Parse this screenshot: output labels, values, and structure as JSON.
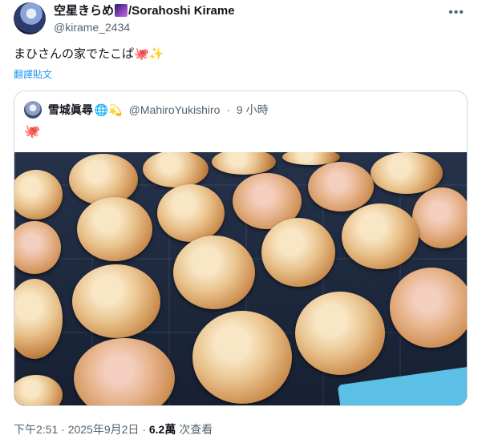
{
  "author": {
    "display_name_prefix": "空星きらめ",
    "display_name_icon": "galaxy-icon",
    "display_name_suffix": "/Sorahoshi Kirame",
    "handle": "@kirame_2434"
  },
  "tweet": {
    "text": "まひさんの家でたこぱ",
    "emoji_octopus": "🐙",
    "emoji_sparkles": "✨",
    "translate_label": "翻譯貼文"
  },
  "quote": {
    "name": "雪城眞尋",
    "globe_icon": "🌐",
    "sparkle_icon": "💫",
    "handle": "@MahiroYukishiro",
    "separator": "·",
    "time": "9 小時",
    "text_emoji": "🐙",
    "image_subject": "takoyaki-photo"
  },
  "meta": {
    "time": "下午2:51",
    "sep1": "·",
    "date": "2025年9月2日",
    "sep2": "·",
    "views_count": "6.2萬",
    "views_label": "次查看"
  },
  "colors": {
    "link": "#1d9bf0",
    "secondary": "#536471",
    "border": "#cfd9de"
  }
}
